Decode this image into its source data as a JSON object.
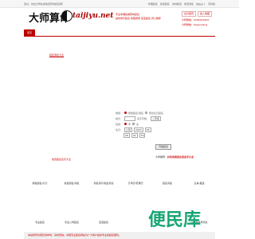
{
  "top_bar": {
    "welcome": "您好，欢迎大师在线免费算命起名网！",
    "links": [
      "命理起名",
      "免费起名",
      "吉祥起名",
      "免费测名",
      "吉凶占卜",
      "手机版"
    ]
  },
  "header": {
    "logo_text": "大师算命",
    "domain": "taijiyu.net",
    "tagline1": "专业命理权威算命起名",
    "tagline2": "提供测字起名 命理测算 宝宝起名 周公解梦",
    "btn_login": "设为首页",
    "btn_fav": "加入收藏",
    "phone": "大师微信：0285293409",
    "wechat": "大师微信：taijiyuwang"
  },
  "nav": {
    "home": "首页"
  },
  "section_link": "起名测名大全",
  "form": {
    "type_label": "类型：",
    "type_opt1": "按姓起名/测名",
    "type_opt2": "按出生日起名",
    "surname_label": "姓氏：",
    "name_label": "名字字数：",
    "name_value": "二字名",
    "gender_label": "性别：",
    "gender_male": "男",
    "gender_female": "女",
    "birth_label": "生日：",
    "calendar": "公历",
    "year": "2015",
    "month": "06",
    "day": "26",
    "hour": "01",
    "minute": "30",
    "submit": "开始起名"
  },
  "hints": {
    "left": "免费起名名字大全",
    "right_prefix": "大师推荐：",
    "right_link": "好听的男孩女孩名字大全"
  },
  "row1": [
    "按姓起名/打分",
    "免费起名/测名",
    "测名测字/姓名测试",
    "万年历/老黄历",
    "起名问答",
    "生肖/星座"
  ],
  "row2": [
    "专业起名",
    "专业公司起名",
    "宝宝起名",
    "",
    "",
    "QQ/手机号测试"
  ],
  "watermark": "便民库",
  "footer": "本站所有内容仅供参考，请勿轻信。中国专业起名网站为广大客户提供专业的起名服务。"
}
